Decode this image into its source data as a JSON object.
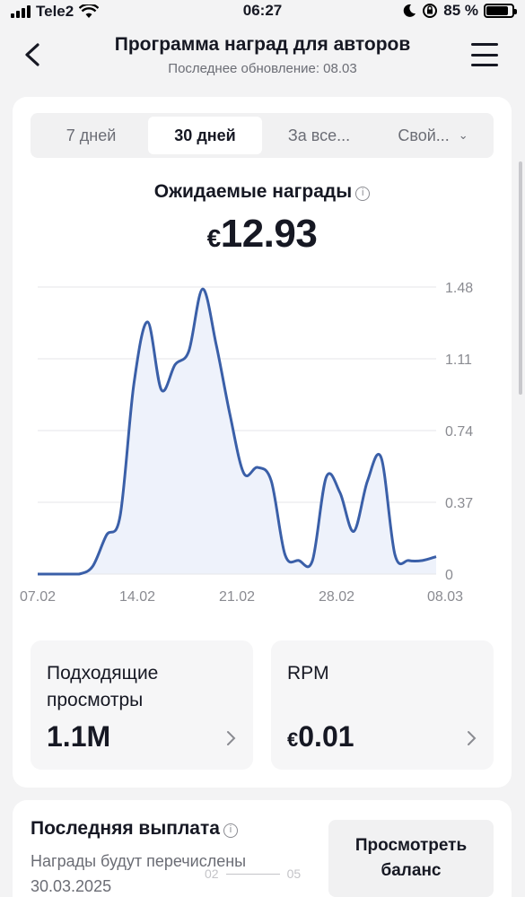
{
  "status_bar": {
    "carrier": "Tele2",
    "time": "06:27",
    "battery": "85 %",
    "battery_level": 0.85
  },
  "header": {
    "title": "Программа наград для авторов",
    "subtitle": "Последнее обновление: 08.03"
  },
  "tabs": [
    {
      "label": "7 дней",
      "active": false
    },
    {
      "label": "30 дней",
      "active": true
    },
    {
      "label": "За все...",
      "active": false
    },
    {
      "label": "Свой...",
      "active": false
    }
  ],
  "rewards": {
    "label": "Ожидаемые награды",
    "currency": "€",
    "amount": "12.93"
  },
  "chart_data": {
    "type": "area",
    "x_ticks": [
      "07.02",
      "14.02",
      "21.02",
      "28.02",
      "08.03"
    ],
    "y_ticks": [
      "1.48",
      "1.11",
      "0.74",
      "0.37",
      "0"
    ],
    "ylim": [
      0,
      1.48
    ],
    "grid": true,
    "line_color": "#3a5fa8",
    "fill_color": "#eef2fb",
    "series": [
      {
        "x": [
          "07.02",
          "08.02",
          "09.02",
          "10.02",
          "11.02",
          "12.02",
          "13.02",
          "14.02",
          "15.02",
          "16.02",
          "17.02",
          "18.02",
          "19.02",
          "20.02",
          "21.02",
          "22.02",
          "23.02",
          "24.02",
          "25.02",
          "26.02",
          "27.02",
          "28.02",
          "01.03",
          "02.03",
          "03.03",
          "04.03",
          "05.03",
          "06.03",
          "07.03",
          "08.03"
        ],
        "values": [
          0,
          0,
          0,
          0,
          0.04,
          0.2,
          0.3,
          0.98,
          1.3,
          0.95,
          1.08,
          1.15,
          1.47,
          1.18,
          0.82,
          0.52,
          0.55,
          0.48,
          0.1,
          0.07,
          0.07,
          0.5,
          0.42,
          0.22,
          0.48,
          0.6,
          0.1,
          0.07,
          0.07,
          0.09
        ]
      }
    ]
  },
  "stats": [
    {
      "label": "Подходящие просмотры",
      "value": "1.1M"
    },
    {
      "label": "RPM",
      "currency": "€",
      "value": "0.01"
    }
  ],
  "payout": {
    "title": "Последняя выплата",
    "text": "Награды будут перечислены 30.03.2025",
    "button": "Просмотреть баланс"
  },
  "pager": {
    "left": "02",
    "right": "05"
  }
}
